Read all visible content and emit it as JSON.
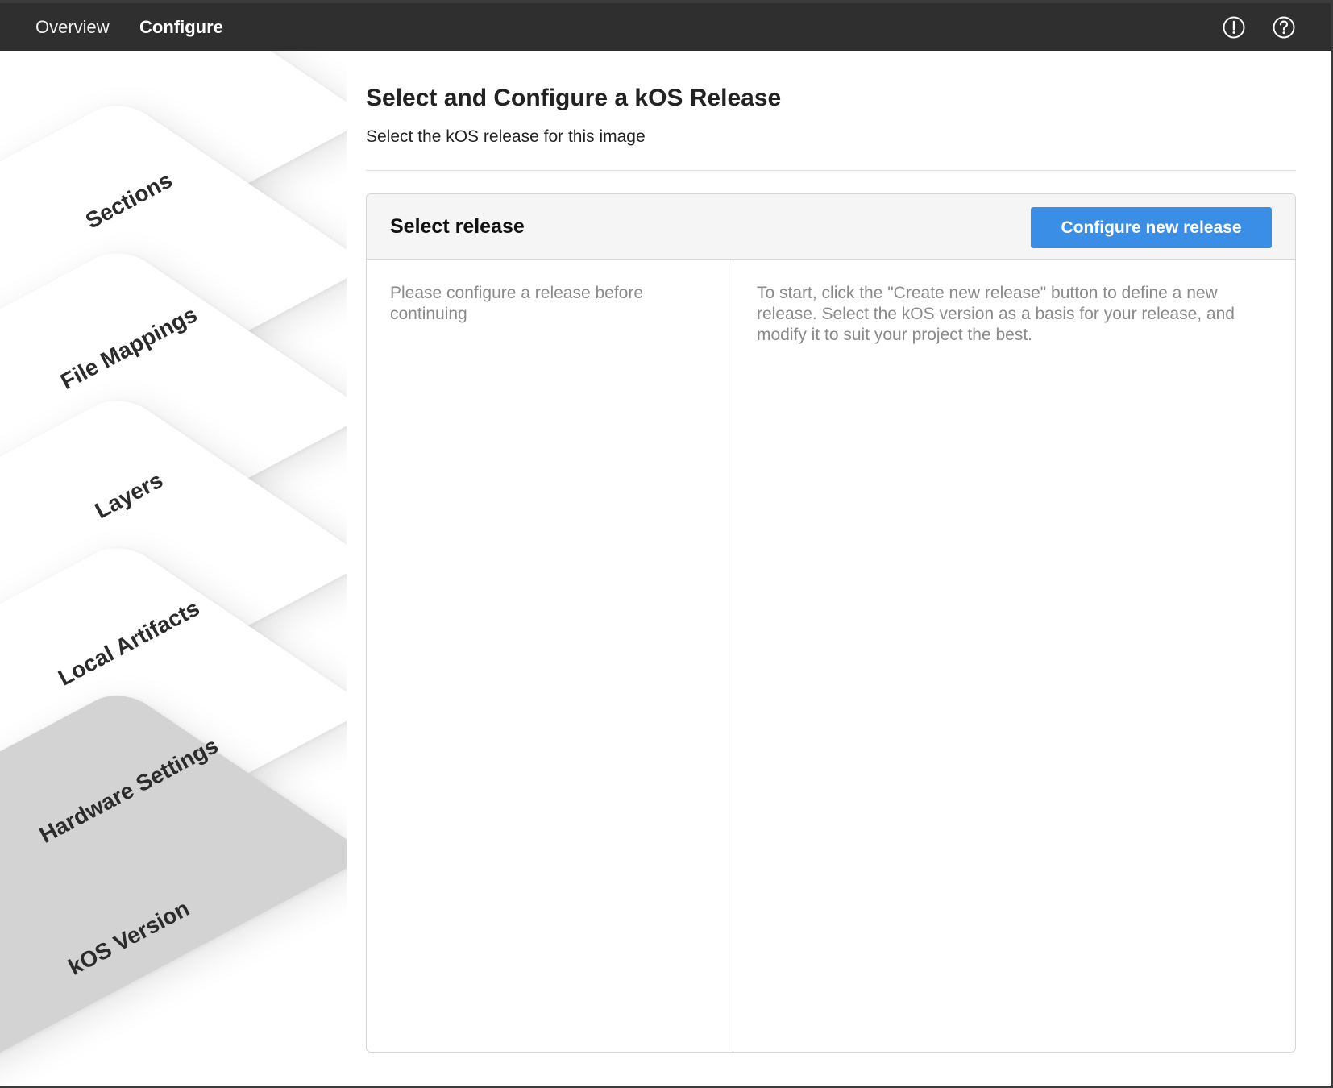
{
  "topbar": {
    "tabs": [
      {
        "label": "Overview",
        "active": false
      },
      {
        "label": "Configure",
        "active": true
      }
    ],
    "icons": [
      "alert-circle-icon",
      "help-circle-icon"
    ]
  },
  "sidebar": {
    "items": [
      {
        "label": "Sections",
        "active": false
      },
      {
        "label": "File Mappings",
        "active": false
      },
      {
        "label": "Layers",
        "active": false
      },
      {
        "label": "Local Artifacts",
        "active": false
      },
      {
        "label": "Hardware Settings",
        "active": false
      },
      {
        "label": "kOS Version",
        "active": true
      }
    ]
  },
  "main": {
    "title": "Select and Configure a kOS Release",
    "subtitle": "Select the kOS release for this image",
    "panel": {
      "title": "Select release",
      "button_label": "Configure new release",
      "left_message": "Please configure a release before continuing",
      "right_message": "To start, click the \"Create new release\" button to define a new release. Select the kOS version as a basis for your release, and modify it to suit your project the best."
    }
  },
  "colors": {
    "topbar_bg": "#2f2f2f",
    "accent": "#3a8ee6",
    "active_card": "#d3d3d3",
    "muted_text": "#8a8a8a"
  }
}
